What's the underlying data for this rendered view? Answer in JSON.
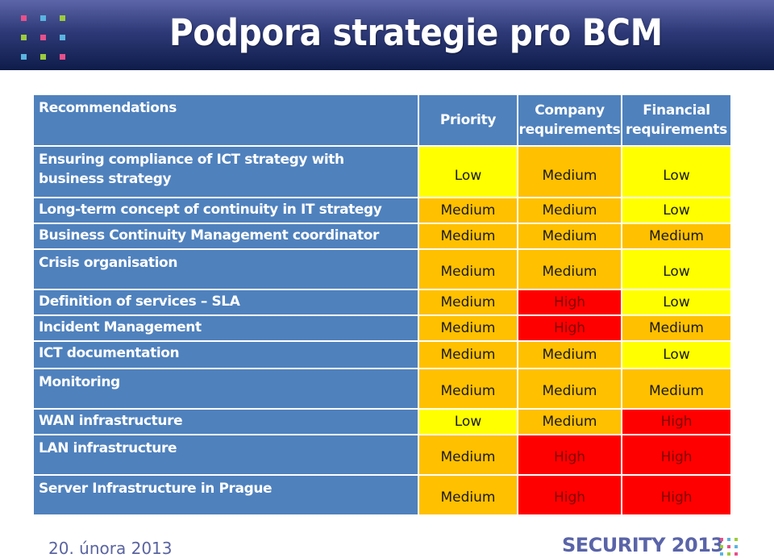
{
  "header": {
    "title": "Podpora strategie pro BCM",
    "logo_colors": [
      [
        "#e8508a",
        "#5ab4e0",
        "#9ccc3c"
      ],
      [
        "#9ccc3c",
        "#e8508a",
        "#5ab4e0"
      ],
      [
        "#5ab4e0",
        "#9ccc3c",
        "#e8508a"
      ]
    ]
  },
  "table": {
    "columns": [
      "Recommendations",
      "Priority",
      "Company requirements",
      "Financial requirements"
    ],
    "level_colors": {
      "Low": "#ffff00",
      "Medium": "#ffc000",
      "High": "#ff0000"
    },
    "rows": [
      {
        "recommendation": "Ensuring compliance of ICT strategy with business strategy",
        "priority": "Low",
        "company": "Medium",
        "financial": "Low"
      },
      {
        "recommendation": "Long-term concept of continuity in IT strategy",
        "priority": "Medium",
        "company": "Medium",
        "financial": "Low"
      },
      {
        "recommendation": "Business Continuity Management coordinator",
        "priority": "Medium",
        "company": "Medium",
        "financial": "Medium"
      },
      {
        "recommendation": "Crisis organisation",
        "priority": "Medium",
        "company": "Medium",
        "financial": "Low"
      },
      {
        "recommendation": "Definition of services – SLA",
        "priority": "Medium",
        "company": "High",
        "financial": "Low"
      },
      {
        "recommendation": "Incident Management",
        "priority": "Medium",
        "company": "High",
        "financial": "Medium"
      },
      {
        "recommendation": "ICT documentation",
        "priority": "Medium",
        "company": "Medium",
        "financial": "Low"
      },
      {
        "recommendation": "Monitoring",
        "priority": "Medium",
        "company": "Medium",
        "financial": "Medium"
      },
      {
        "recommendation": "WAN infrastructure",
        "priority": "Low",
        "company": "Medium",
        "financial": "High"
      },
      {
        "recommendation": "LAN infrastructure",
        "priority": "Medium",
        "company": "High",
        "financial": "High"
      },
      {
        "recommendation": "Server Infrastructure in Prague",
        "priority": "Medium",
        "company": "High",
        "financial": "High"
      }
    ]
  },
  "footer": {
    "date": "20. února 2013",
    "brand": "SECURITY 2013"
  }
}
